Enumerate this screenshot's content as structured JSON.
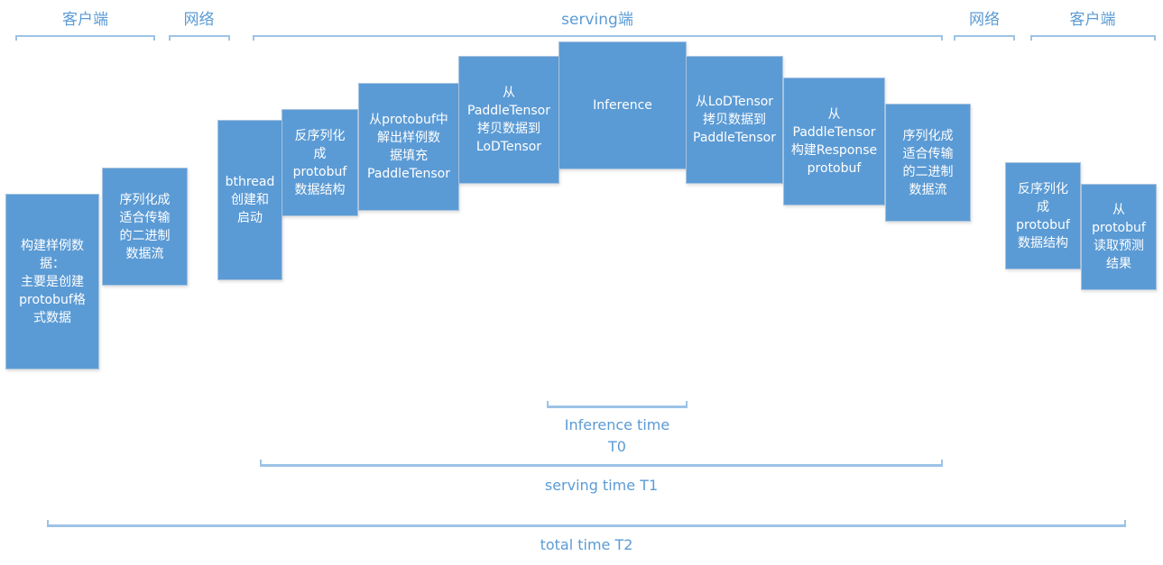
{
  "phases": [
    {
      "label": "客户端"
    },
    {
      "label": "网络"
    },
    {
      "label": "serving端"
    },
    {
      "label": "网络"
    },
    {
      "label": "客户端"
    }
  ],
  "steps": [
    {
      "label": "构建样例数\n据：\n主要是创建\nprotobuf格\n式数据",
      "phase": "客户端"
    },
    {
      "label": "序列化成\n适合传输\n的二进制\n数据流",
      "phase": "客户端"
    },
    {
      "label": "bthread\n创建和\n启动",
      "phase": "serving端"
    },
    {
      "label": "反序列化\n成\nprotobuf\n数据结构",
      "phase": "serving端"
    },
    {
      "label": "从protobuf中\n解出样例数\n据填充\nPaddleTensor",
      "phase": "serving端"
    },
    {
      "label": "从\nPaddleTensor\n拷贝数据到\nLoDTensor",
      "phase": "serving端"
    },
    {
      "label": "Inference",
      "phase": "serving端"
    },
    {
      "label": "从LoDTensor\n拷贝数据到\nPaddleTensor",
      "phase": "serving端"
    },
    {
      "label": "从\nPaddleTensor\n构建Response\nprotobuf",
      "phase": "serving端"
    },
    {
      "label": "序列化成\n适合传输\n的二进制\n数据流",
      "phase": "serving端"
    },
    {
      "label": "反序列化\n成\nprotobuf\n数据结构",
      "phase": "客户端"
    },
    {
      "label": "从\nprotobuf\n读取预测\n结果",
      "phase": "客户端"
    }
  ],
  "timings": [
    {
      "label": "Inference time\nT0"
    },
    {
      "label": "serving time T1"
    },
    {
      "label": "total time T2"
    }
  ]
}
